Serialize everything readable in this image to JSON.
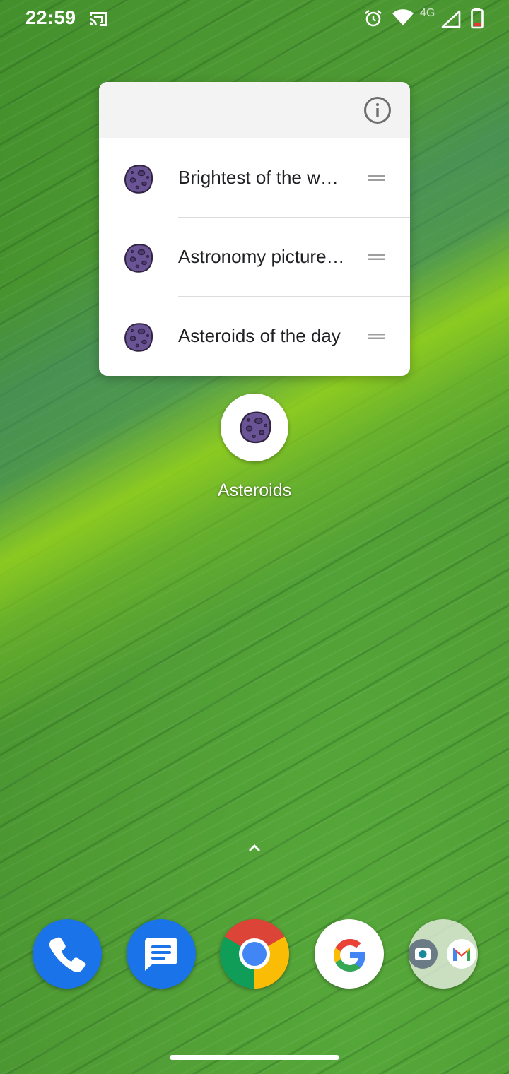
{
  "status_bar": {
    "time": "22:59",
    "network_label": "4G",
    "icons": [
      "cast-icon",
      "alarm-icon",
      "wifi-icon",
      "signal-icon",
      "battery-icon"
    ]
  },
  "popup": {
    "header_icons": [
      "info-icon"
    ],
    "shortcuts": [
      {
        "label": "Brightest of the w…",
        "icon": "asteroid-icon"
      },
      {
        "label": "Astronomy picture…",
        "icon": "asteroid-icon"
      },
      {
        "label": "Asteroids of the day",
        "icon": "asteroid-icon"
      }
    ]
  },
  "app": {
    "label": "Asteroids",
    "icon": "asteroid-icon"
  },
  "dock": {
    "items": [
      "phone-icon",
      "messages-icon",
      "chrome-icon",
      "google-icon",
      "camera-gmail-folder-icon"
    ]
  },
  "colors": {
    "asteroid_purple": "#6b5496",
    "asteroid_outline": "#2f2340",
    "phone_blue": "#1a73e8",
    "google_blue": "#4285f4",
    "google_red": "#ea4335",
    "google_yellow": "#fbbc05",
    "google_green": "#34a853"
  }
}
